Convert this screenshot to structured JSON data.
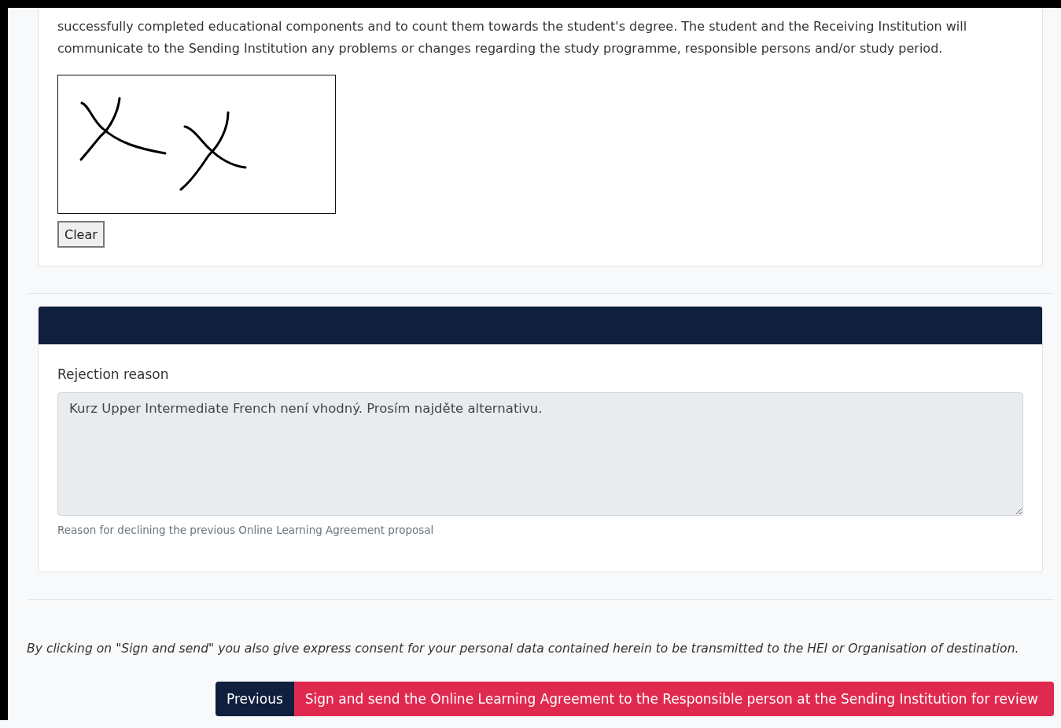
{
  "agreement_text": "successfully completed educational components and to count them towards the student's degree. The student and the Receiving Institution will communicate to the Sending Institution any problems or changes regarding the study programme, responsible persons and/or study period.",
  "signature": {
    "clear_button": "Clear"
  },
  "rejection": {
    "label": "Rejection reason",
    "value": "Kurz Upper Intermediate French není vhodný. Prosím najděte alternativu.",
    "disabled": true,
    "help": "Reason for declining the previous Online Learning Agreement proposal"
  },
  "consent_text": "By clicking on \"Sign and send\" you also give express consent for your personal data contained herein to be transmitted to the HEI or Organisation of destination.",
  "buttons": [
    {
      "label": "Previous",
      "kind": "secondary"
    },
    {
      "label": "Sign and send the Online Learning Agreement to the Responsible person at the Sending Institution for review",
      "kind": "primary"
    }
  ]
}
